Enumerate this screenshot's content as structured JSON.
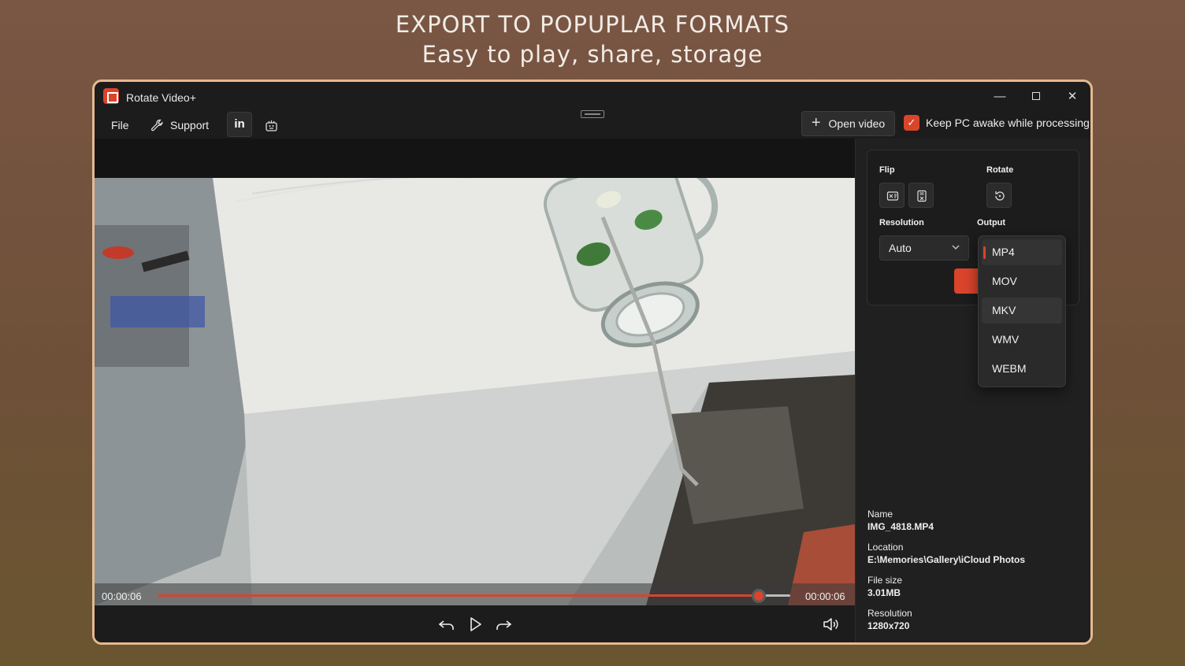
{
  "promo": {
    "title": "EXPORT TO POPUPLAR FORMATS",
    "subtitle": "Easy to play, share, storage"
  },
  "window": {
    "title": "Rotate Video+",
    "controls": [
      "minimize-icon",
      "maximize-icon",
      "close-icon"
    ]
  },
  "menu": {
    "file": "File",
    "support": "Support",
    "linkedin": "in"
  },
  "toolbar": {
    "open_video": "Open video",
    "keep_awake_label": "Keep PC awake while processing",
    "keep_awake_checked": true
  },
  "player": {
    "current_time": "00:00:06",
    "total_time": "00:00:06",
    "progress": 0.95
  },
  "panel": {
    "flip_label": "Flip",
    "rotate_label": "Rotate",
    "resolution_label": "Resolution",
    "resolution_value": "Auto",
    "output_label": "Output",
    "output_options": [
      "MP4",
      "MOV",
      "MKV",
      "WMV",
      "WEBM"
    ],
    "output_selected": "MP4",
    "output_hovered": "MKV"
  },
  "file_info": {
    "name_label": "Name",
    "name_value": "IMG_4818.MP4",
    "location_label": "Location",
    "location_value": "E:\\Memories\\Gallery\\iCloud Photos",
    "size_label": "File size",
    "size_value": "3.01MB",
    "resolution_label": "Resolution",
    "resolution_value": "1280x720"
  },
  "colors": {
    "accent": "#d9442b",
    "frame_border": "#e6b990",
    "window_bg": "#1c1c1c"
  }
}
